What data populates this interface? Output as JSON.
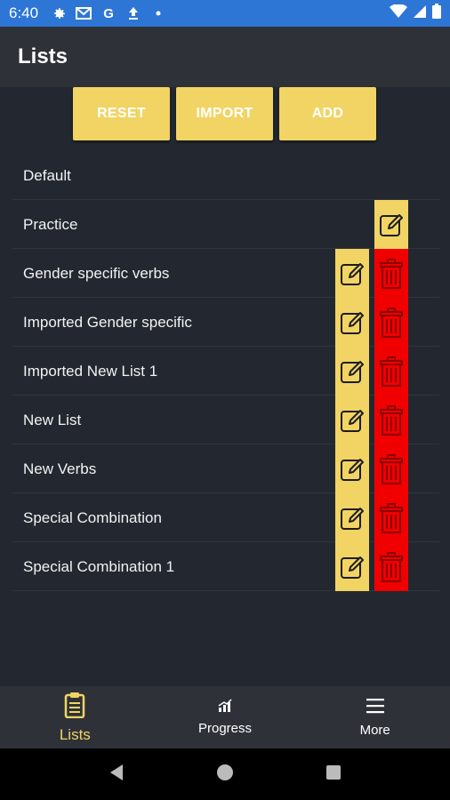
{
  "status_bar": {
    "time": "6:40",
    "left_icons": [
      "gear-icon",
      "gmail-icon",
      "google-icon",
      "upload-icon",
      "dot-icon"
    ],
    "google_glyph": "G",
    "right_icons": [
      "wifi-icon",
      "signal-icon",
      "battery-icon"
    ]
  },
  "app_bar": {
    "title": "Lists"
  },
  "actions": {
    "reset": "RESET",
    "import": "IMPORT",
    "add": "ADD"
  },
  "lists": [
    {
      "name": "Default",
      "editable": false,
      "deletable": false
    },
    {
      "name": "Practice",
      "editable": true,
      "deletable": false
    },
    {
      "name": "Gender specific verbs",
      "editable": true,
      "deletable": true
    },
    {
      "name": "Imported Gender specific",
      "editable": true,
      "deletable": true
    },
    {
      "name": "Imported New List 1",
      "editable": true,
      "deletable": true
    },
    {
      "name": "New List",
      "editable": true,
      "deletable": true
    },
    {
      "name": "New Verbs",
      "editable": true,
      "deletable": true
    },
    {
      "name": "Special Combination",
      "editable": true,
      "deletable": true
    },
    {
      "name": "Special Combination 1",
      "editable": true,
      "deletable": true
    }
  ],
  "bottom_nav": [
    {
      "label": "Lists",
      "icon": "clipboard-icon",
      "active": true
    },
    {
      "label": "Progress",
      "icon": "chart-icon",
      "active": false
    },
    {
      "label": "More",
      "icon": "menu-icon",
      "active": false
    }
  ],
  "system_nav": [
    "back-icon",
    "home-icon",
    "recents-icon"
  ],
  "colors": {
    "accent_yellow": "#f1d464",
    "delete_red": "#f00000",
    "status_bar": "#2d76d6",
    "background": "#232830"
  }
}
